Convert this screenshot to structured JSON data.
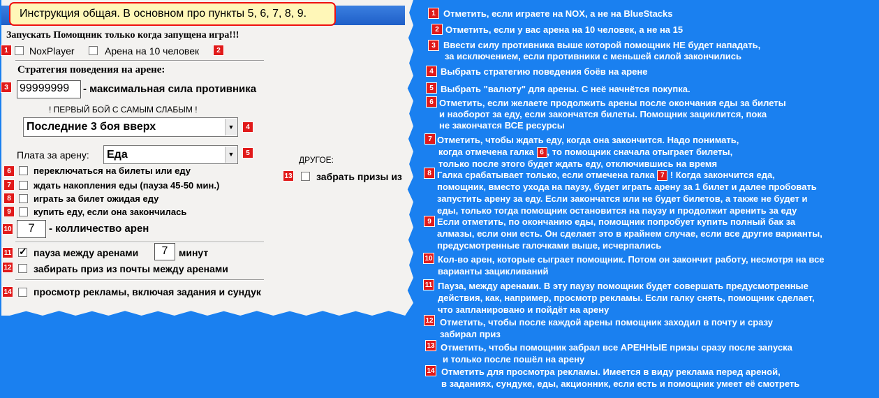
{
  "header": {
    "title": "Инструкция общая. В основном про пункты 5, 6, 7, 8, 9."
  },
  "warning": "Запускать Помощник только когда запущена игра!!!",
  "top_checks": {
    "nox": {
      "badge": "1",
      "label": "NoxPlayer",
      "checked": false
    },
    "arena10": {
      "badge": "2",
      "label": "Арена на 10 человек",
      "checked": false
    }
  },
  "strategy": {
    "heading": "Стратегия поведения на арене:",
    "max_power": {
      "badge": "3",
      "value": "99999999",
      "label": "- максимальная сила противника"
    },
    "first_fight": "! ПЕРВЫЙ БОЙ С САМЫМ СЛАБЫМ !",
    "mode_select": {
      "badge": "4",
      "value": "Последние 3 боя вверх"
    }
  },
  "payment": {
    "label": "Плата за арену:",
    "value": "Еда",
    "badge": "5"
  },
  "other": {
    "heading": "ДРУГОЕ:",
    "badge": "13",
    "label": "забрать призы из",
    "checked": false
  },
  "options": [
    {
      "badge": "6",
      "label": "переключаться на билеты или еду",
      "checked": false
    },
    {
      "badge": "7",
      "label": "ждать накопления еды (пауза 45-50 мин.)",
      "checked": false
    },
    {
      "badge": "8",
      "label": "играть за билет ожидая еду",
      "checked": false
    },
    {
      "badge": "9",
      "label": "купить еду, если она закончилась",
      "checked": false
    }
  ],
  "arena_count": {
    "badge": "10",
    "value": "7",
    "label": "- колличество арен"
  },
  "pause": {
    "badge": "11",
    "label": "пауза между аренами",
    "value": "7",
    "unit": "минут",
    "checked": true
  },
  "mail": {
    "badge": "12",
    "label": "забирать приз из почты между аренами",
    "checked": false
  },
  "ads": {
    "badge": "14",
    "label": "просмотр рекламы, включая задания и сундук",
    "checked": false
  },
  "notes": {
    "n1": {
      "badge": "1",
      "lines": [
        "Отметить, если играете на NOX, а не на BlueStacks"
      ]
    },
    "n2": {
      "badge": "2",
      "lines": [
        "Отметить, если у вас арена на 10 человек, а не на 15"
      ]
    },
    "n3": {
      "badge": "3",
      "lines": [
        "Ввести силу противника выше которой помощник НЕ будет нападать,",
        "за исключением, если противники с меньшей силой закончились"
      ]
    },
    "n4": {
      "badge": "4",
      "lines": [
        "Выбрать стратегию поведения боёв на арене"
      ]
    },
    "n5": {
      "badge": "5",
      "lines": [
        "Выбрать \"валюту\" для арены. С неё начнётся покупка."
      ]
    },
    "n6": {
      "badge": "6",
      "lines": [
        "Отметить, если желаете продолжить арены после окончания еды за билеты",
        "и наоборот за еду, если закончатся билеты. Помощник зациклится, пока",
        "не закончатся ВСЕ ресурсы"
      ]
    },
    "n7": {
      "badge": "7",
      "l1": "Отметить, чтобы ждать еду, когда она закончится. Надо понимать,",
      "l2a": "когда отмечена галка",
      "l2ref": "6",
      "l2b": ", то помощник сначала отыграет билеты,",
      "l3": "только после этого будет ждать еду, отключившись на время"
    },
    "n8": {
      "badge": "8",
      "l1a": "Галка срабатывает только, если отмечена галка",
      "l1ref": "7",
      "l1b": "! Когда закончится еда,",
      "lines": [
        "помощник,  вместо ухода на паузу, будет играть арену за 1 билет и далее пробовать",
        "запустить арену за еду. Если закончатся или не будет билетов, а также не будет и",
        "еды, только тогда помощник остановится на паузу и продолжит аренить за еду"
      ]
    },
    "n9": {
      "badge": "9",
      "lines": [
        "Если отметить, по окончанию еды, помощник попробует купить полный бак за",
        "алмазы, если они есть. Он сделает это в крайнем случае, если все другие варианты,",
        "предусмотренные галочками выше, исчерпались"
      ]
    },
    "n10": {
      "badge": "10",
      "lines": [
        "Кол-во арен, которые сыграет помощник. Потом он закончит работу, несмотря на все",
        "варианты зацикливаний"
      ]
    },
    "n11": {
      "badge": "11",
      "lines": [
        "Пауза, между аренами. В эту паузу помощник будет совершать предусмотренные",
        "действия, как, например, просмотр рекламы. Если галку снять, помощник сделает,",
        "что запланировано и пойдёт на арену"
      ]
    },
    "n12": {
      "badge": "12",
      "lines": [
        "Отметить, чтобы после каждой арены помощник заходил в почту и сразу",
        "забирал приз"
      ]
    },
    "n13": {
      "badge": "13",
      "lines": [
        "Отметить, чтобы помощник забрал все АРЕННЫЕ призы сразу после запуска",
        "и только после пошёл на арену"
      ]
    },
    "n14": {
      "badge": "14",
      "lines": [
        "Отметить для просмотра рекламы. Имеется в виду реклама перед ареной,",
        "в заданиях, сундуке, еды, акционник, если есть и помощник умеет её смотреть"
      ]
    }
  },
  "colors": {
    "background": "#1a80f0",
    "panel": "#f3f2f0",
    "badge": "#e11a1a",
    "title_box": "#fff7b8"
  }
}
